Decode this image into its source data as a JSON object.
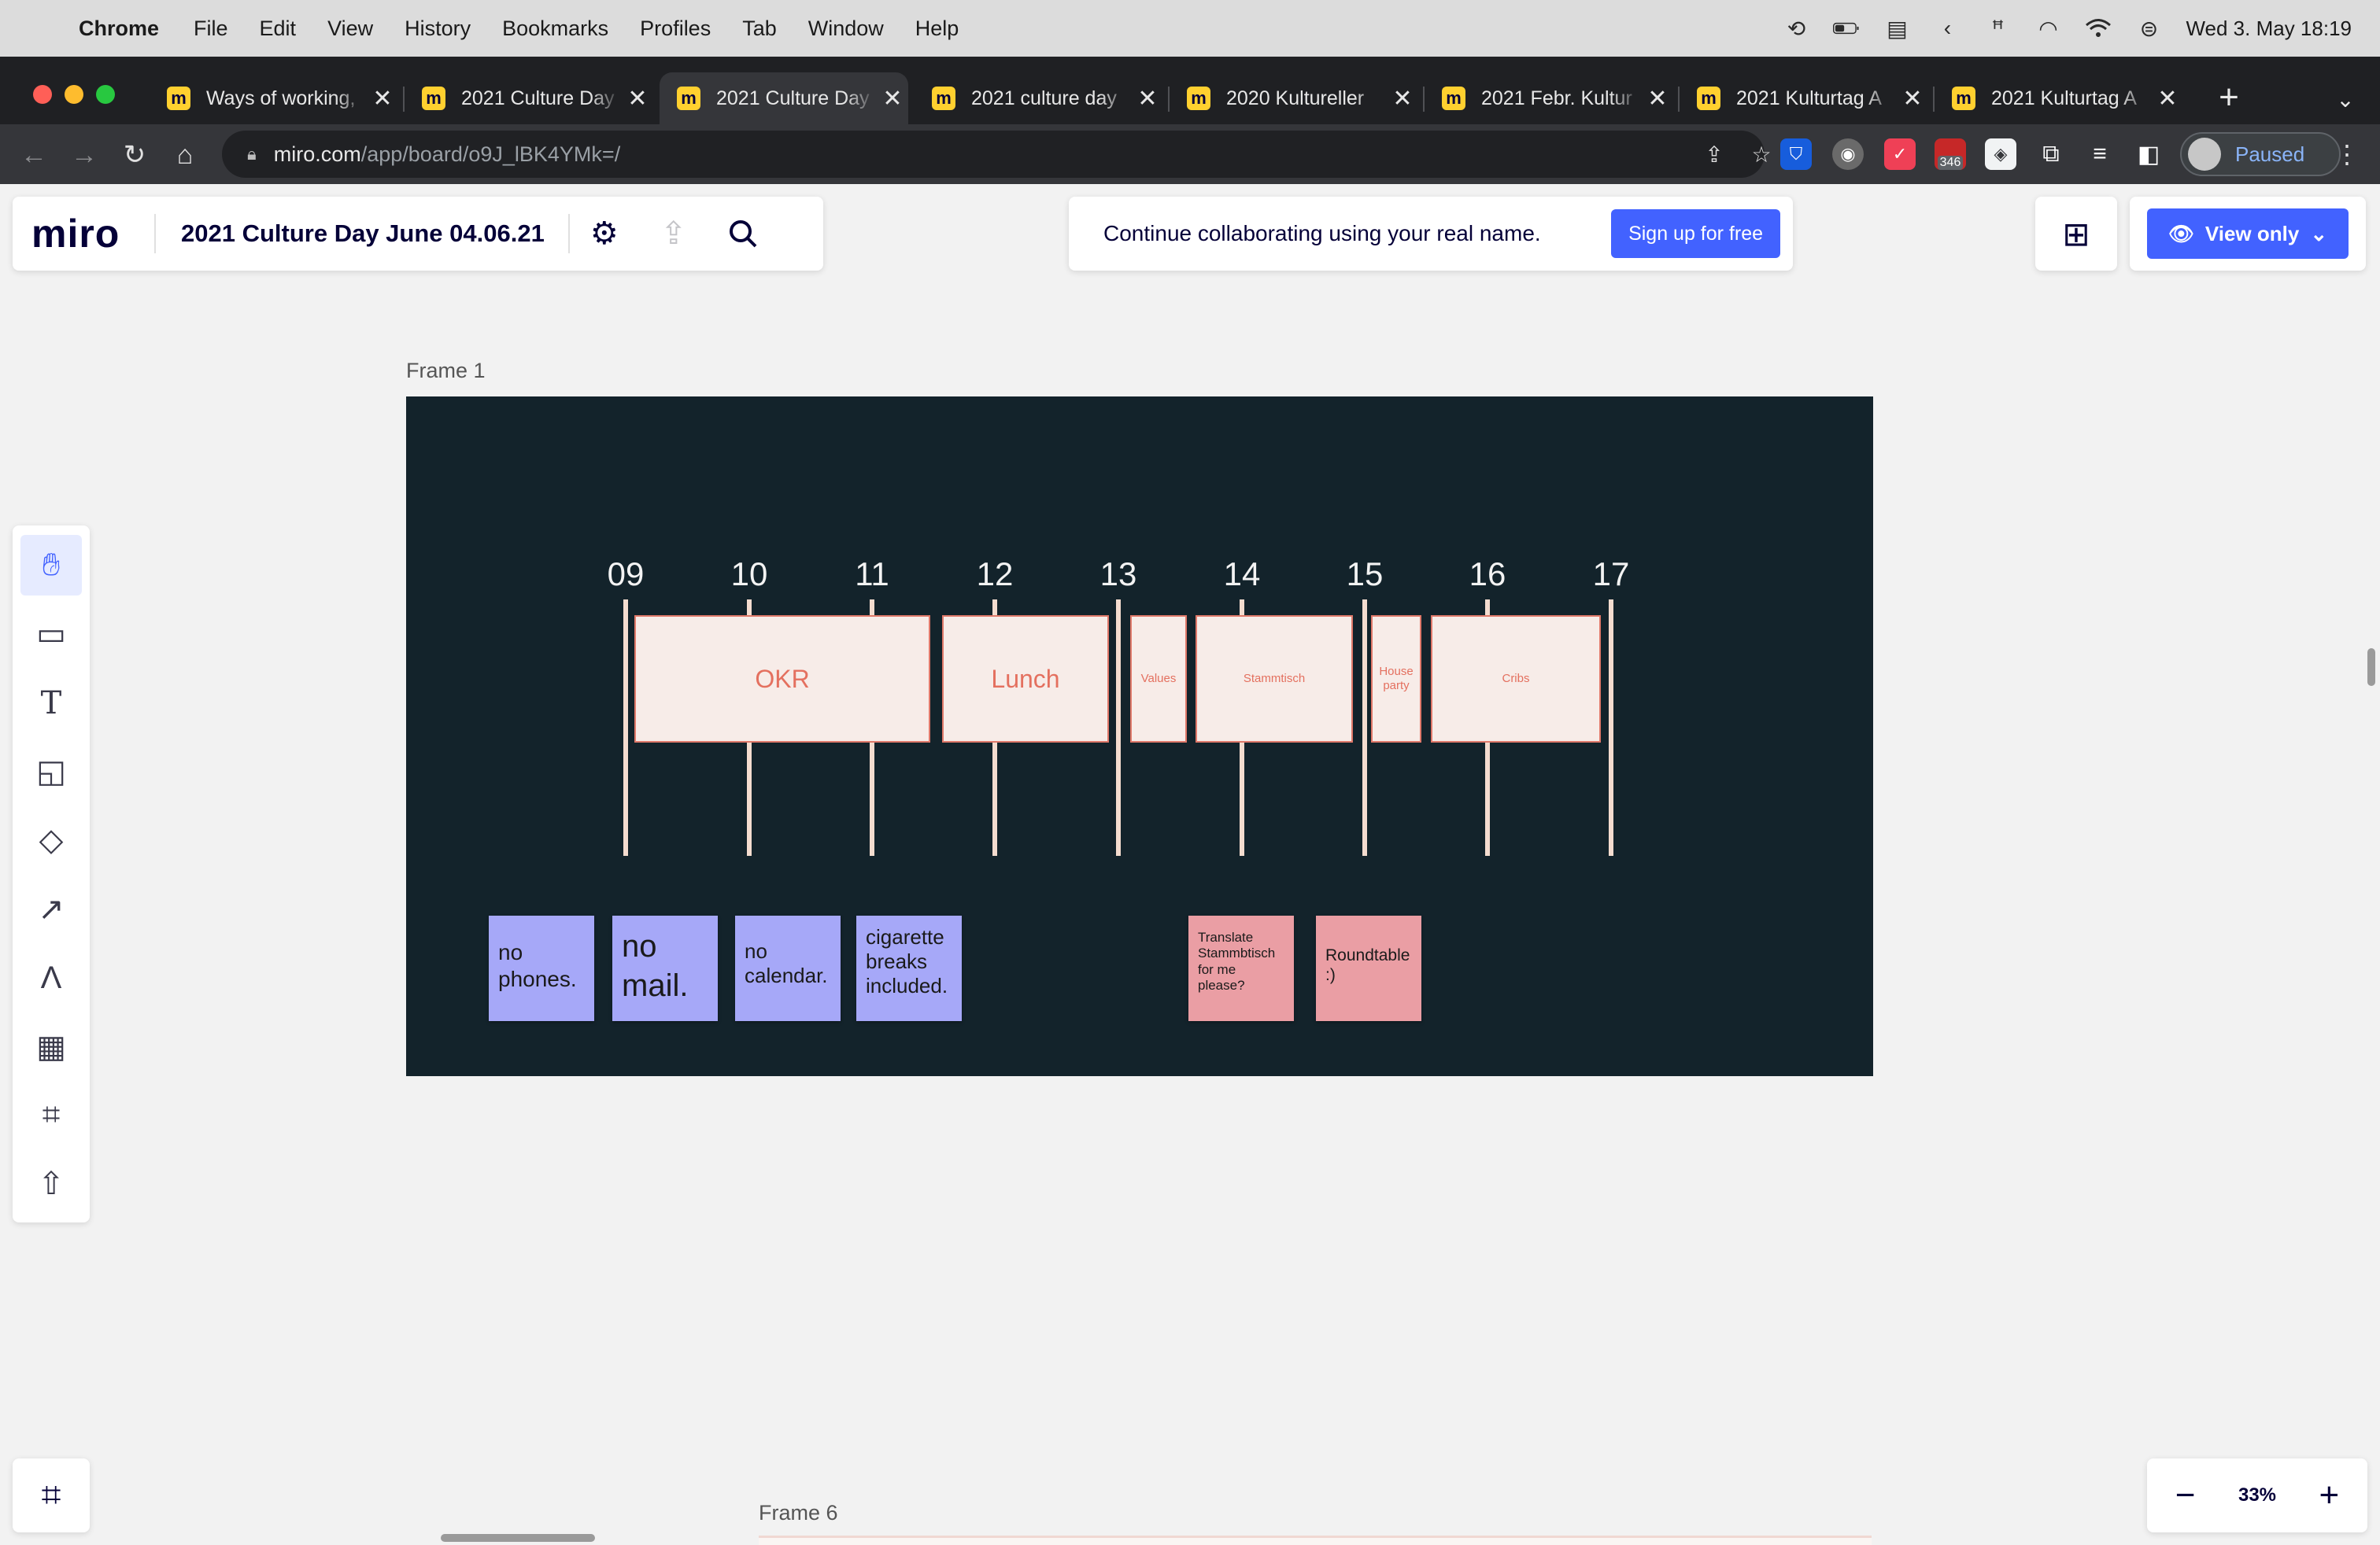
{
  "menubar": {
    "app": "Chrome",
    "items": [
      "File",
      "Edit",
      "View",
      "History",
      "Bookmarks",
      "Profiles",
      "Tab",
      "Window",
      "Help"
    ],
    "datetime": "Wed 3. May  18:19"
  },
  "tabs": [
    {
      "title": "Ways of working,",
      "active": false
    },
    {
      "title": "2021 Culture Day",
      "active": false
    },
    {
      "title": "2021 Culture Day",
      "active": true
    },
    {
      "title": "2021 culture day",
      "active": false
    },
    {
      "title": "2020 Kultureller",
      "active": false
    },
    {
      "title": "2021 Febr. Kultur",
      "active": false
    },
    {
      "title": "2021 Kulturtag A",
      "active": false
    },
    {
      "title": "2021 Kulturtag A",
      "active": false
    }
  ],
  "address": {
    "host": "miro.com",
    "path": "/app/board/o9J_lBK4YMk=/"
  },
  "extensions": {
    "badge": "346"
  },
  "profile": {
    "label": "Paused"
  },
  "miro": {
    "logo": "miro",
    "board_title": "2021 Culture Day June 04.06.21",
    "collab_text": "Continue collaborating using your real name.",
    "signup_label": "Sign up for free",
    "view_label": "View only",
    "zoom": "33%",
    "frame1_label": "Frame 1",
    "frame6_label": "Frame 6"
  },
  "timeline": {
    "hours": [
      "09",
      "10",
      "11",
      "12",
      "13",
      "14",
      "15",
      "16",
      "17"
    ],
    "slots": [
      {
        "label": "OKR"
      },
      {
        "label": "Lunch"
      },
      {
        "label": "Values"
      },
      {
        "label": "Stammtisch"
      },
      {
        "label": "House party"
      },
      {
        "label": "Cribs"
      }
    ]
  },
  "stickies": [
    {
      "text": "no phones.",
      "color": "#a6a8f8"
    },
    {
      "text": "no mail.",
      "color": "#a6a8f8"
    },
    {
      "text": "no calendar.",
      "color": "#a6a8f8"
    },
    {
      "text": "cigarette breaks included.",
      "color": "#a6a8f8"
    },
    {
      "text": "Translate Stammbtisch for me please?",
      "color": "#ea9ea4"
    },
    {
      "text": "Roundtable :)",
      "color": "#ea9ea4"
    }
  ],
  "colors": {
    "accent": "#4262ff",
    "frame_bg": "#13232b",
    "slot_text": "#e4705f"
  }
}
